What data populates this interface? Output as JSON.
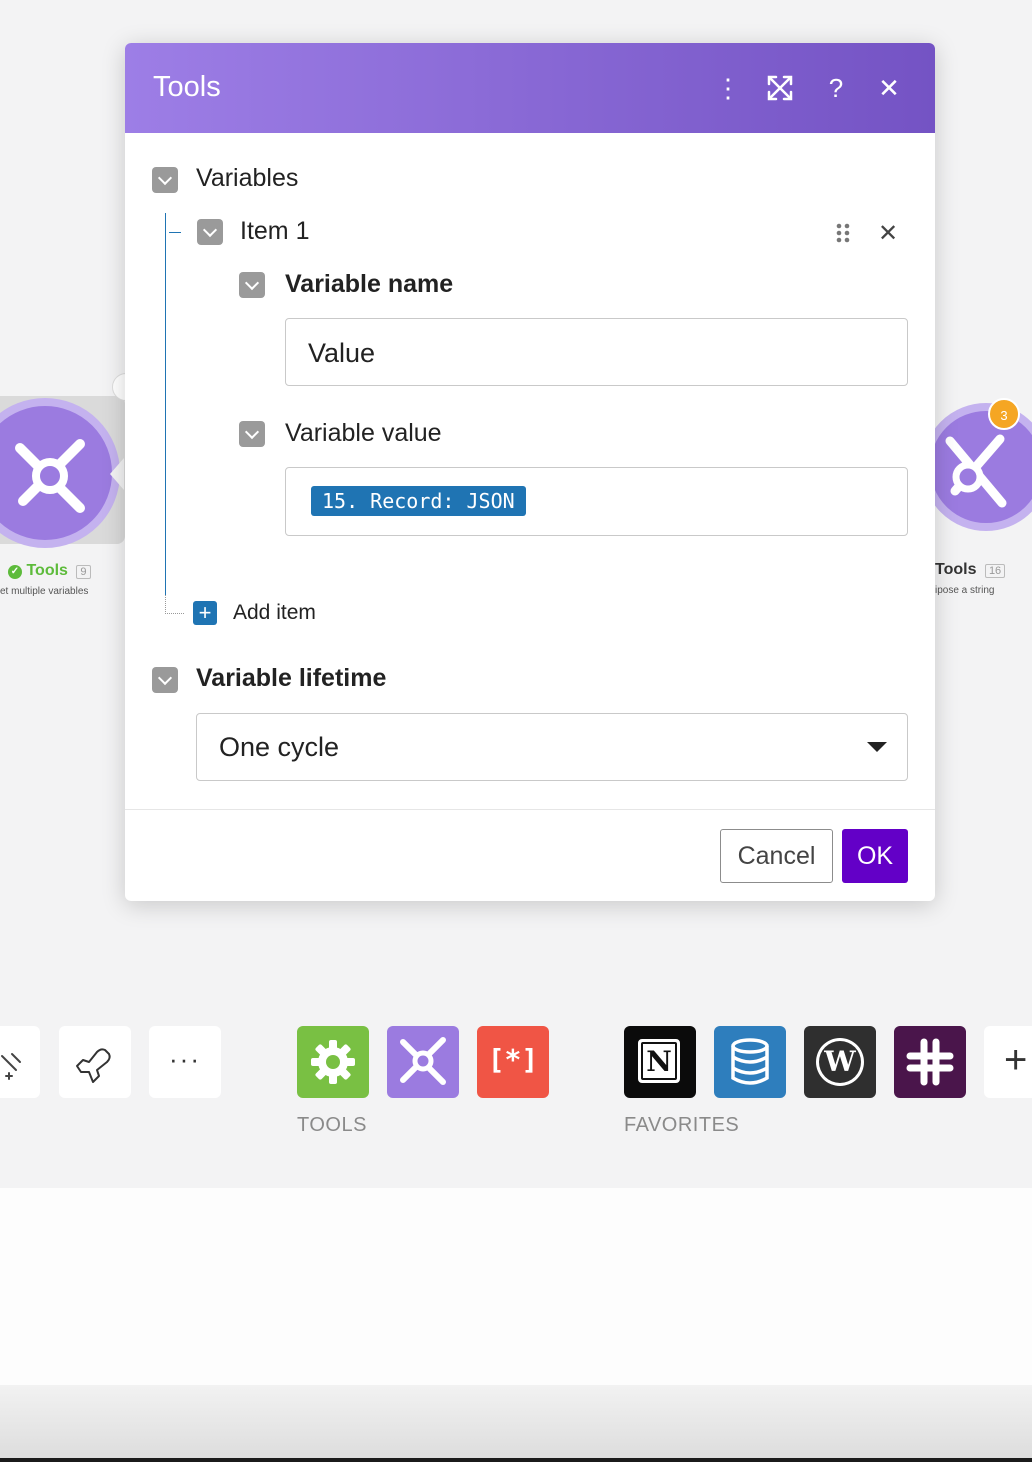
{
  "dialog": {
    "title": "Tools",
    "variables_label": "Variables",
    "item_label": "Item 1",
    "variable_name_label": "Variable name",
    "variable_name_value": "Value",
    "variable_value_label": "Variable value",
    "variable_value_pill": "15. Record: JSON",
    "add_item_label": "Add item",
    "lifetime_label": "Variable lifetime",
    "lifetime_value": "One cycle",
    "cancel_label": "Cancel",
    "ok_label": "OK"
  },
  "canvas": {
    "left_module": {
      "label": "Tools",
      "number": "9",
      "subtitle": "et multiple variables"
    },
    "right_module": {
      "label": "Tools",
      "number": "16",
      "subtitle": "ipose a string",
      "badge": "3"
    }
  },
  "toolbar": {
    "tools_label": "TOOLS",
    "favorites_label": "FAVORITES"
  },
  "colors": {
    "header_start": "#9d7ee6",
    "header_end": "#7453c4",
    "ok_button": "#6300c7",
    "pill": "#1f74b3",
    "tools_green": "#79c043",
    "tools_purple": "#9b7be0",
    "text_parser_red": "#f05545",
    "notion_black": "#0b0b0b",
    "datastore_blue": "#2e7ebd",
    "wordpress_dark": "#2f2f2f",
    "slack_plum": "#4a154b"
  }
}
